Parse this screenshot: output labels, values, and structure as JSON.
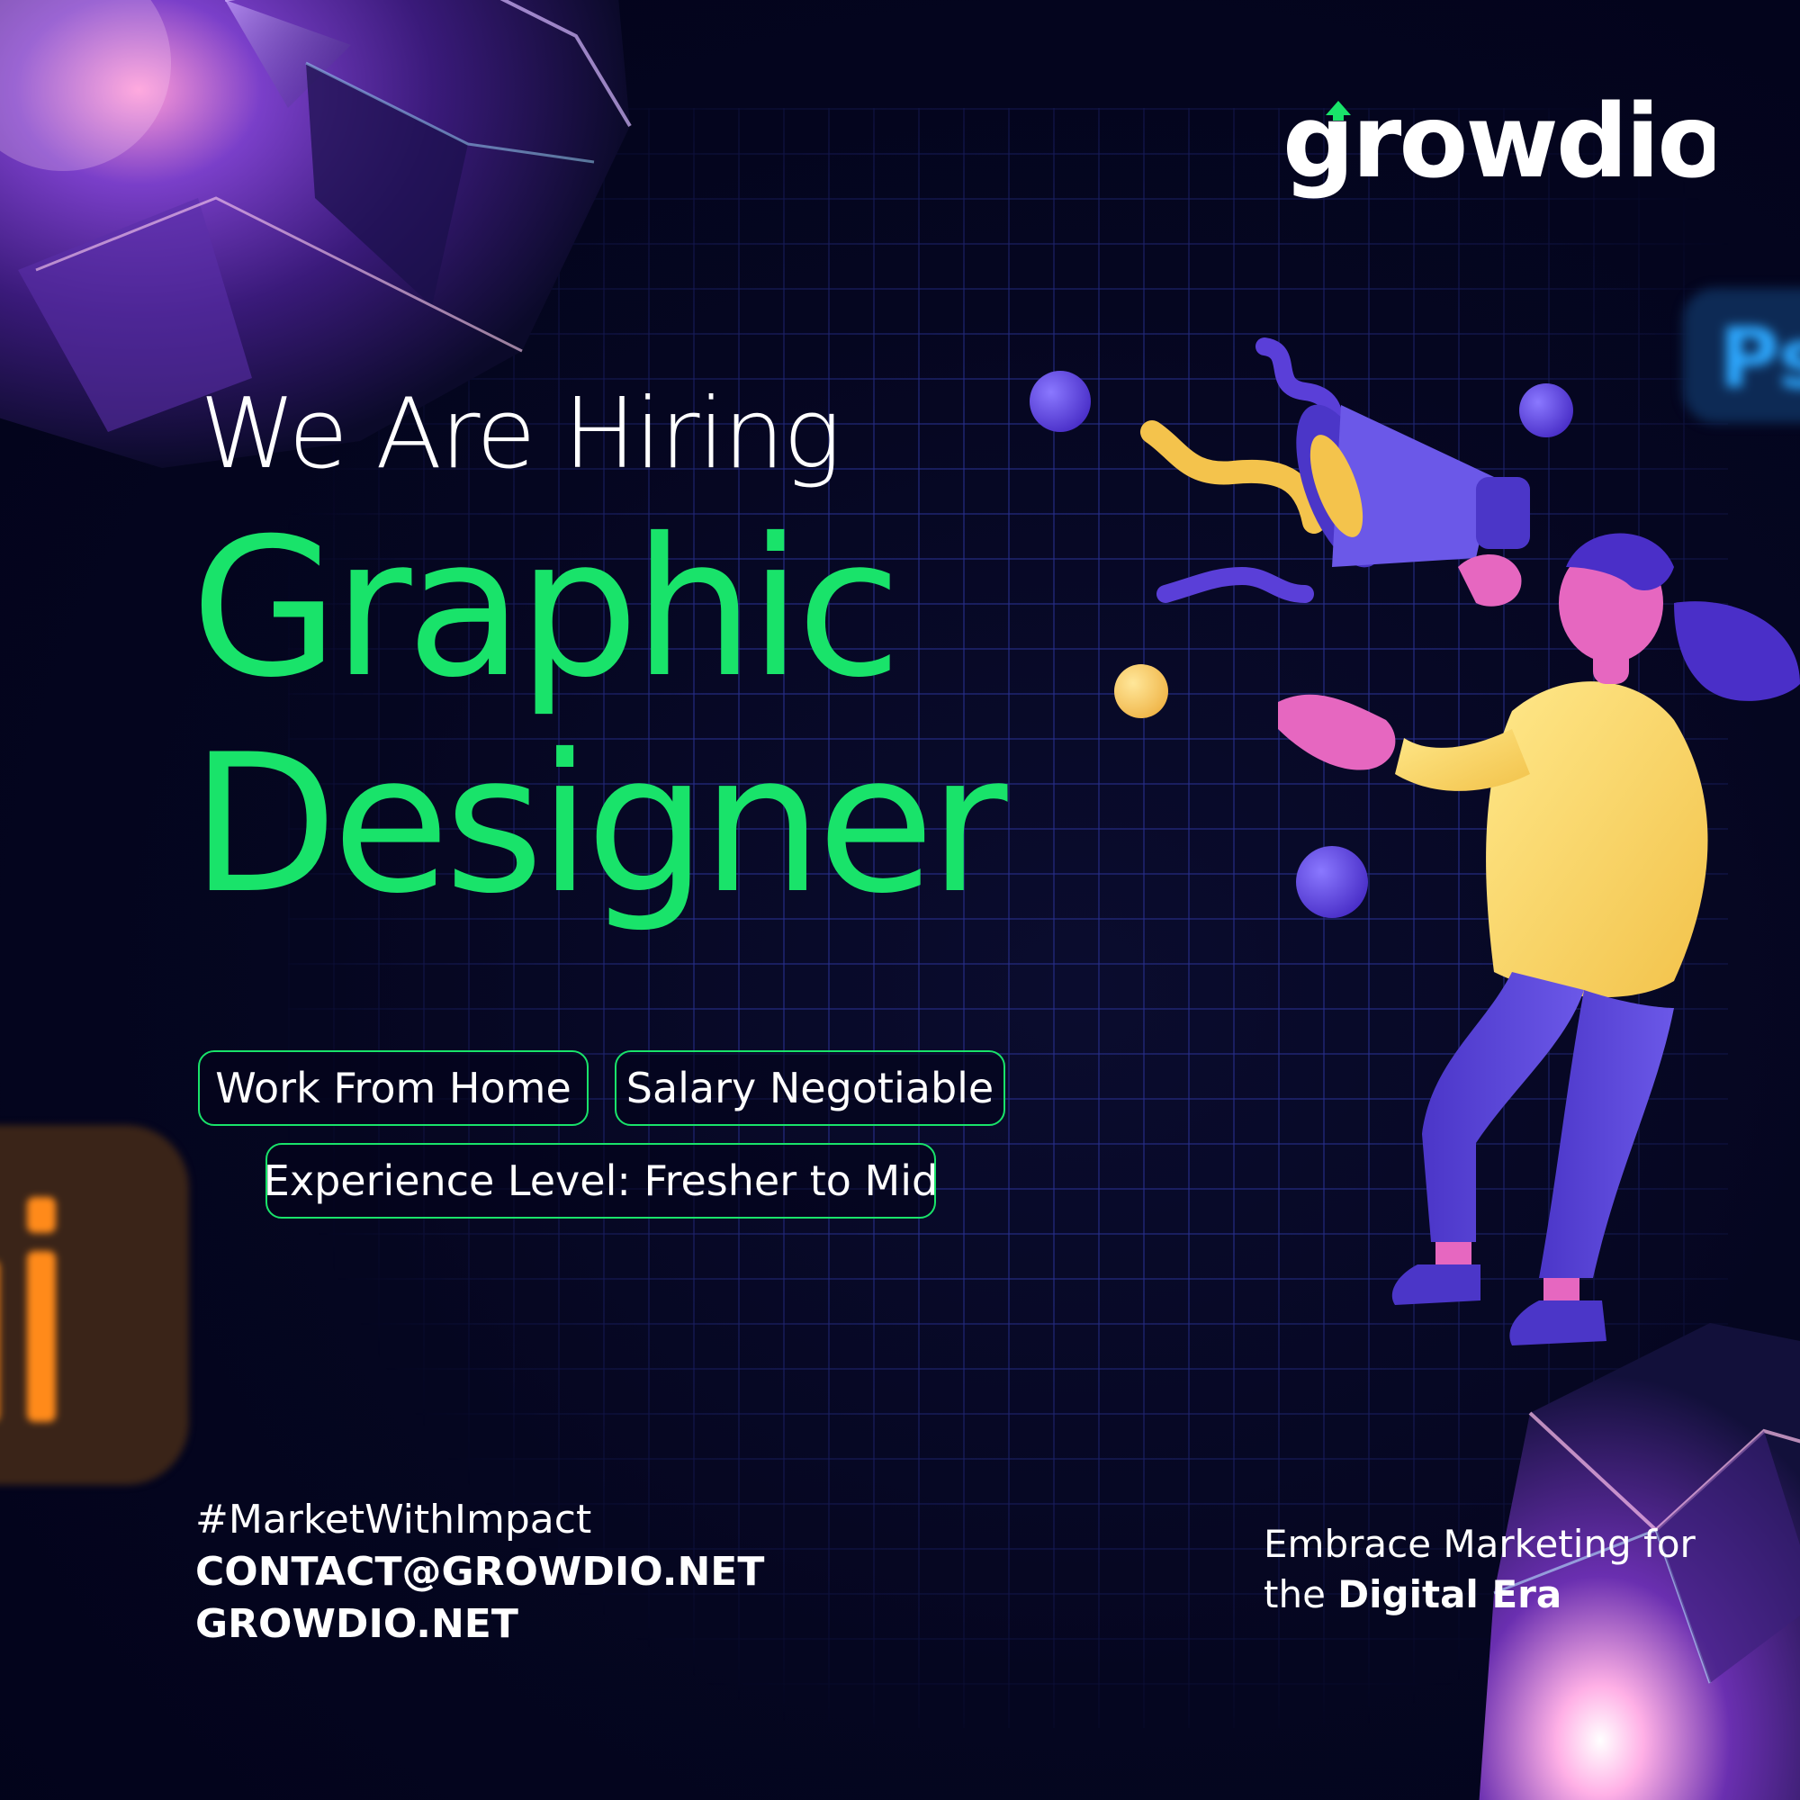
{
  "brand": {
    "logo_text": "growdio",
    "accent_color": "#19e36a"
  },
  "headline": {
    "lead": "We Are Hiring",
    "role_line1": "Graphic",
    "role_line2": "Designer"
  },
  "tags": [
    {
      "label": "Work From Home"
    },
    {
      "label": "Salary Negotiable"
    },
    {
      "label": "Experience Level: Fresher to Mid"
    }
  ],
  "footer": {
    "hashtag": "#MarketWithImpact",
    "email": "CONTACT@GROWDIO.NET",
    "website": "GROWDIO.NET",
    "tagline_part1": "Embrace Marketing for",
    "tagline_part2": "the",
    "tagline_bold": "Digital Era"
  },
  "decor": {
    "background_color": "#03041a",
    "grid_color": "#28308c",
    "illustration": "woman-with-megaphone",
    "app_icons": [
      "photoshop-icon",
      "illustrator-icon"
    ],
    "shapes": [
      "crystal-top",
      "crystal-bottom",
      "confetti-spheres",
      "confetti-squiggles"
    ]
  }
}
